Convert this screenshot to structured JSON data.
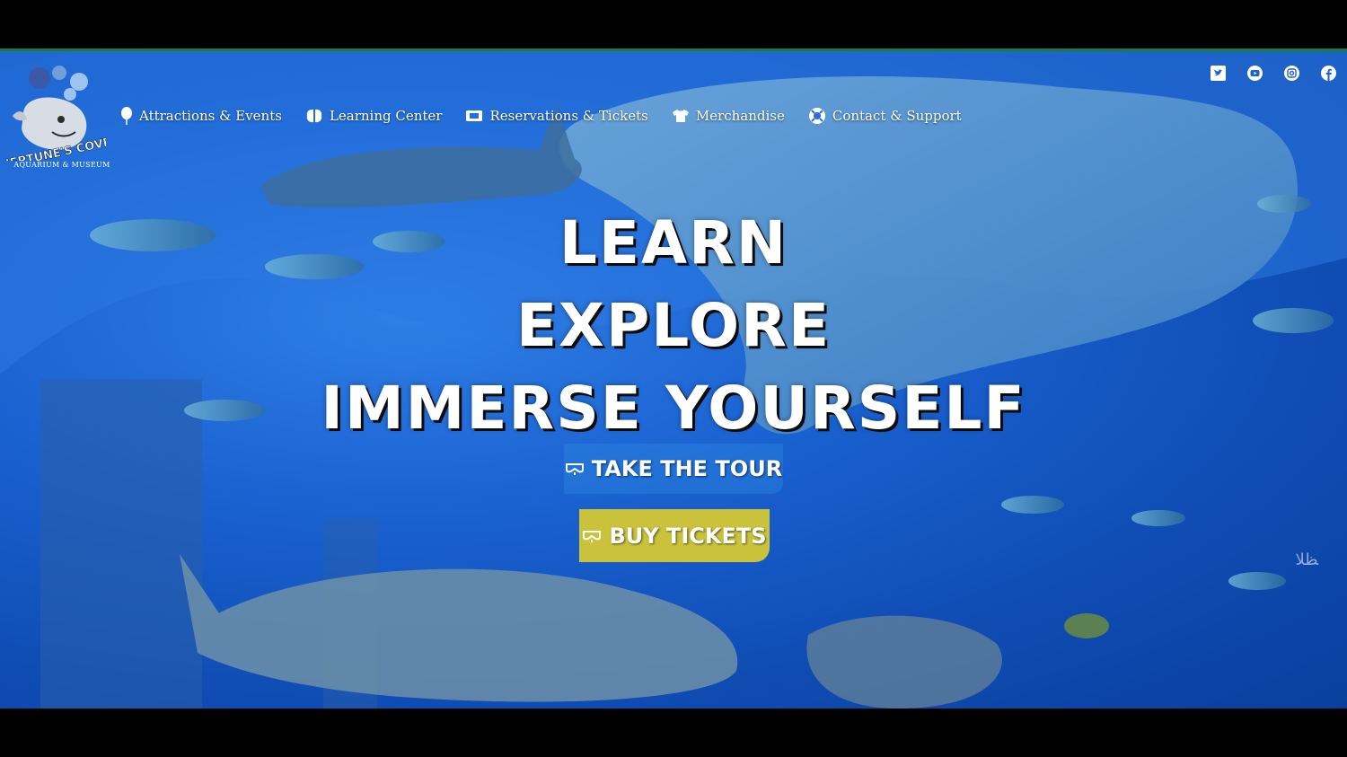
{
  "site": {
    "brand_name": "NEPTUNE'S COVE",
    "brand_subtitle": "AQUARIUM & MUSEUM"
  },
  "nav": {
    "items": [
      {
        "label": "Attractions & Events",
        "icon": "balloon-icon"
      },
      {
        "label": "Learning Center",
        "icon": "brain-icon"
      },
      {
        "label": "Reservations & Tickets",
        "icon": "ticket-icon"
      },
      {
        "label": "Merchandise",
        "icon": "tshirt-icon"
      },
      {
        "label": "Contact & Support",
        "icon": "lifebuoy-icon"
      }
    ]
  },
  "social": [
    {
      "name": "twitter",
      "icon": "twitter-icon"
    },
    {
      "name": "youtube",
      "icon": "youtube-icon"
    },
    {
      "name": "instagram",
      "icon": "instagram-icon"
    },
    {
      "name": "facebook",
      "icon": "facebook-icon"
    }
  ],
  "hero": {
    "lines": [
      "LEARN",
      "EXPLORE",
      "IMMERSE YOURSELF"
    ],
    "tour_label": "TAKE THE TOUR",
    "buy_label": "BUY TICKETS",
    "watermark": "ﻈﻠﺎ"
  },
  "colors": {
    "accent_green": "#1f7a3c",
    "buy_button": "#c9c23a",
    "ocean": "#1a62d1"
  }
}
